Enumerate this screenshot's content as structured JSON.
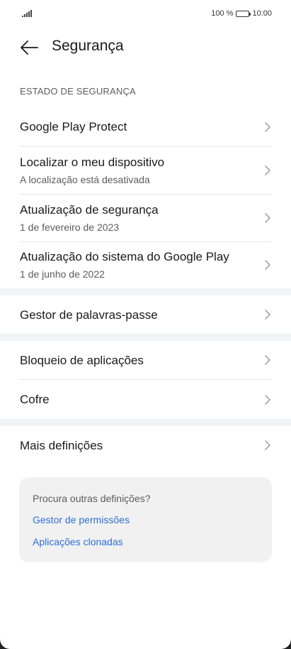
{
  "status_bar": {
    "battery_text": "100 %",
    "time": "10:00"
  },
  "app_bar": {
    "title": "Segurança",
    "back_icon": "arrow-left-icon"
  },
  "security_state": {
    "header": "ESTADO DE SEGURANÇA",
    "items": [
      {
        "title": "Google Play Protect",
        "subtitle": ""
      },
      {
        "title": "Localizar o meu dispositivo",
        "subtitle": "A localização está desativada"
      },
      {
        "title": "Atualização de segurança",
        "subtitle": "1 de fevereiro de 2023"
      },
      {
        "title": "Atualização do sistema do Google Play",
        "subtitle": "1 de junho de 2022"
      }
    ]
  },
  "password_manager": {
    "title": "Gestor de palavras-passe"
  },
  "apps_group": {
    "items": [
      {
        "title": "Bloqueio de aplicações"
      },
      {
        "title": "Cofre"
      }
    ]
  },
  "more": {
    "title": "Mais definições"
  },
  "suggestions": {
    "question": "Procura outras definições?",
    "links": [
      "Gestor de permissões",
      "Aplicações clonadas"
    ]
  },
  "colors": {
    "link": "#2f6fd6",
    "band": "#f1f3f5"
  }
}
